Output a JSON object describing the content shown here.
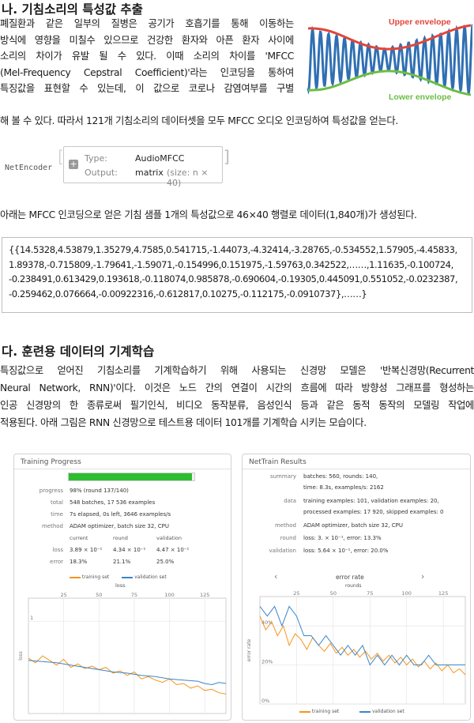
{
  "section1": {
    "heading": "나. 기침소리의 특성값 추출",
    "lines": [
      "폐질환과 같은 일부의 질병은 공기가 호흡기를 통해 이동하는",
      "방식에 영향을 미칠수 있으므로 건강한 환자와 아픈 환자 사이에",
      "소리의 차이가 유발 될 수 있다. 이때 소리의 차이를 'MFCC",
      "(Mel-Frequency Cepstral Coefficient)'라는 인코딩을 통하여",
      "특징값을 표현할 수 있는데, 이 값으로 코로나 감염여부를 구별",
      "해 볼 수 있다. 따라서 121개 기침소리의 데이터셋을 모두 MFCC 오디오 인코딩하여 특성값을 얻는다."
    ],
    "envelope": {
      "upper": "Upper envelope",
      "lower": "Lower envelope",
      "upper_color": "#e2463a",
      "lower_color": "#6cbd45",
      "wave_color": "#2f6fb3"
    }
  },
  "encoder": {
    "name": "NetEncoder",
    "type_label": "Type:",
    "type_value": "AudioMFCC",
    "output_label": "Output:",
    "output_value": "matrix",
    "output_size": "(size: n × 40)"
  },
  "caption1": "아래는 MFCC 인코딩으로 얻은 기침 샘플 1개의 특성값으로 46×40 행렬로 데이터(1,840개)가 생성된다.",
  "datablock": [
    "{{14.5328,4.53879,1.35279,4.7585,0.541715,-1.44073,-4.32414,-3.28765,-0.534552,1.57905,-4.45833,",
    "1.89378,-0.715809,-1.79641,-1.59071,-0.154996,0.151975,-1.59763,0.342522,……,1.11635,-0.100724,",
    "-0.238491,0.613429,0.193618,-0.118074,0.985878,-0.690604,-0.19305,0.445091,0.551052,-0.0232387,",
    "-0.259462,0.076664,-0.00922316,-0.612817,0.10275,-0.112175,-0.0910737},……}"
  ],
  "section2": {
    "heading": "다. 훈련용 데이터의 기계학습",
    "lines": [
      "특징값으로 얻어진 기침소리를 기계학습하기 위해 사용되는 신경망 모델은 '반복신경망(Recurrent",
      "Neural Network, RNN)'이다. 이것은 노드 간의 연결이 시간의 흐름에 따라 방향성 그래프를 형성하는",
      "인공 신경망의 한 종류로써 필기인식, 비디오 동작분류, 음성인식 등과 같은 동적 동작의 모델링 작업에",
      "적용된다. 아래 그림은 RNN 신경망으로 테스트용 데이터 101개를 기계학습 시키는 모습이다."
    ]
  },
  "training": {
    "title": "Training Progress",
    "progress_fraction": 0.98,
    "progress_color": "#2ebd2e",
    "rows": [
      {
        "label": "progress",
        "value": "98% (round 137/140)"
      },
      {
        "label": "total",
        "value": "548 batches, 17 536 examples"
      },
      {
        "label": "time",
        "value": "7s elapsed, 0s left, 3646 examples/s"
      },
      {
        "label": "method",
        "value": "ADAM optimizer, batch size 32, CPU"
      }
    ],
    "col_headers": [
      "current",
      "round",
      "validation"
    ],
    "loss_label": "loss",
    "loss_values": [
      "3.89 × 10⁻¹",
      "4.34 × 10⁻¹",
      "4.47 × 10⁻¹"
    ],
    "error_label": "error",
    "error_values": [
      "18.3%",
      "21.1%",
      "25.0%"
    ],
    "legend_train": "training set",
    "legend_val": "validation set",
    "plot_title": "loss",
    "ylabel": "loss",
    "y_tick": "1",
    "x_ticks": [
      "25",
      "50",
      "75",
      "100",
      "125"
    ]
  },
  "results": {
    "title": "NetTrain Results",
    "rows": [
      {
        "label": "summary",
        "value": "batches: 560, rounds: 140,",
        "value2": "time: 8.3s, examples/s: 2162"
      },
      {
        "label": "data",
        "value": "training examples: 101, validation examples: 20,",
        "value2": "processed examples: 17 920, skipped examples: 0"
      },
      {
        "label": "method",
        "value": "ADAM optimizer, batch size 32, CPU",
        "value2": ""
      },
      {
        "label": "round",
        "value": "loss: 3. × 10⁻¹, error: 13.3%",
        "value2": ""
      },
      {
        "label": "validation",
        "value": "loss: 5.64 × 10⁻¹, error: 20.0%",
        "value2": ""
      }
    ],
    "plot_title": "error rate",
    "plot_sub": "rounds",
    "nav_prev": "‹",
    "nav_next": "›",
    "ylabel": "error rate",
    "y_ticks": [
      "40%",
      "20%",
      "0%"
    ],
    "x_ticks": [
      "25",
      "50",
      "75",
      "100",
      "125"
    ],
    "legend_train": "training set",
    "legend_val": "validation set"
  },
  "chart_data": [
    {
      "type": "line",
      "title": "loss",
      "xlabel": "",
      "ylabel": "loss",
      "x_ticks": [
        25,
        50,
        75,
        100,
        125
      ],
      "y_ticks": [
        1
      ],
      "xlim": [
        0,
        140
      ],
      "series": [
        {
          "name": "training set",
          "color": "#f7941d",
          "x": [
            0,
            5,
            10,
            15,
            20,
            25,
            30,
            35,
            40,
            45,
            50,
            55,
            60,
            65,
            70,
            75,
            80,
            85,
            90,
            95,
            100,
            105,
            110,
            115,
            120,
            125,
            130,
            135,
            140
          ],
          "values": [
            0.68,
            0.64,
            0.7,
            0.66,
            0.62,
            0.67,
            0.6,
            0.63,
            0.59,
            0.61,
            0.58,
            0.6,
            0.55,
            0.57,
            0.53,
            0.56,
            0.5,
            0.52,
            0.49,
            0.47,
            0.5,
            0.45,
            0.46,
            0.42,
            0.44,
            0.4,
            0.41,
            0.38,
            0.37
          ]
        },
        {
          "name": "validation set",
          "color": "#3a86c8",
          "x": [
            0,
            10,
            20,
            30,
            40,
            50,
            60,
            70,
            80,
            90,
            100,
            110,
            120,
            125,
            130,
            135,
            140
          ],
          "values": [
            0.66,
            0.65,
            0.64,
            0.62,
            0.6,
            0.58,
            0.56,
            0.55,
            0.53,
            0.52,
            0.5,
            0.49,
            0.48,
            0.46,
            0.45,
            0.47,
            0.46
          ]
        }
      ]
    },
    {
      "type": "line",
      "title": "error rate",
      "xlabel": "rounds",
      "ylabel": "error rate",
      "x_ticks": [
        25,
        50,
        75,
        100,
        125
      ],
      "y_ticks": [
        "0%",
        "20%",
        "40%"
      ],
      "xlim": [
        0,
        140
      ],
      "ylim": [
        0,
        55
      ],
      "series": [
        {
          "name": "training set",
          "color": "#f7941d",
          "x": [
            0,
            4,
            8,
            12,
            16,
            20,
            24,
            28,
            32,
            36,
            40,
            44,
            48,
            52,
            56,
            60,
            64,
            68,
            72,
            76,
            80,
            84,
            88,
            92,
            96,
            100,
            104,
            108,
            112,
            116,
            120,
            124,
            128,
            132,
            136,
            140
          ],
          "values": [
            45,
            38,
            42,
            35,
            40,
            30,
            36,
            33,
            28,
            34,
            30,
            27,
            31,
            26,
            29,
            25,
            28,
            24,
            27,
            23,
            26,
            22,
            25,
            21,
            24,
            20,
            23,
            19,
            22,
            18,
            21,
            17,
            20,
            16,
            18,
            15
          ]
        },
        {
          "name": "validation set",
          "color": "#3a86c8",
          "x": [
            0,
            5,
            10,
            15,
            20,
            25,
            30,
            35,
            40,
            45,
            50,
            55,
            60,
            65,
            70,
            75,
            80,
            85,
            90,
            95,
            100,
            105,
            110,
            115,
            120,
            125,
            130,
            135,
            140
          ],
          "values": [
            50,
            45,
            50,
            40,
            50,
            45,
            35,
            35,
            30,
            35,
            30,
            25,
            30,
            25,
            30,
            20,
            25,
            20,
            25,
            20,
            25,
            20,
            20,
            25,
            20,
            20,
            20,
            20,
            20
          ]
        }
      ]
    }
  ]
}
